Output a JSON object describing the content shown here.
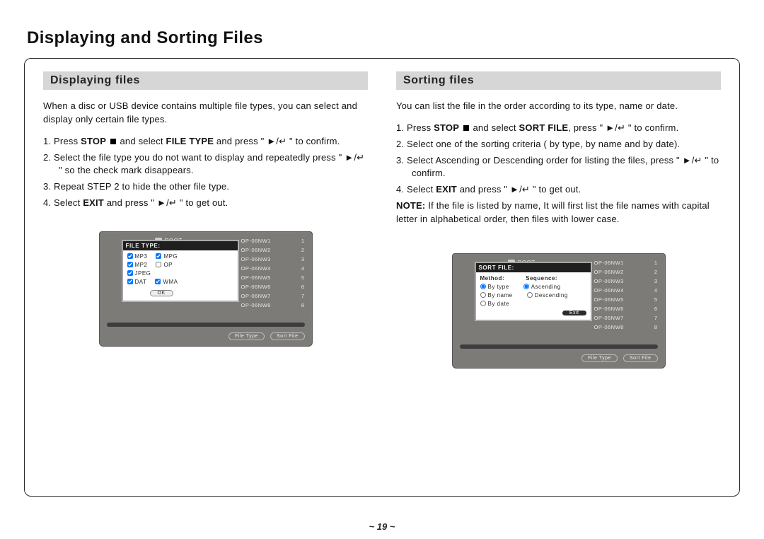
{
  "page_title": "Displaying and Sorting Files",
  "page_number": "~ 19 ~",
  "left": {
    "heading": "Displaying files",
    "intro": "When a disc or USB device contains multiple file types,    you can select and display only certain file types.",
    "steps": [
      {
        "prefix": "1. Press ",
        "b1": "STOP ",
        "mid": "",
        "b2": " and select ",
        "b3": "FILE TYPE",
        "tail": " and press \" ►/↵ \" to confirm."
      },
      {
        "text": "2. Select the file type you do not want to display and repeatedly press \" ►/↵ \" so the check mark disappears."
      },
      {
        "text": "3. Repeat STEP 2 to hide the other file type."
      },
      {
        "prefix": "4. Select ",
        "b1": "EXIT",
        "tail": " and press \" ►/↵ \" to get out."
      }
    ],
    "osd": {
      "root": "ROOT",
      "panel_title": "FILE TYPE:",
      "checks_left": [
        "MP3",
        "MP2",
        "JPEG",
        "DAT"
      ],
      "checks_right": [
        "MPG",
        "OP",
        "",
        "WMA"
      ],
      "ok": "OK",
      "files": [
        "OP-06NW1",
        "OP-06NW2",
        "OP-06NW3",
        "OP-06NW4",
        "OP-06NW5",
        "OP-06NW6",
        "OP-06NW7",
        "OP-06NW8"
      ],
      "foot1": "File Type",
      "foot2": "Sort File"
    }
  },
  "right": {
    "heading": "Sorting files",
    "intro": "You can list the file in the order according to its type, name or date.",
    "steps": [
      {
        "prefix": "1. Press ",
        "b1": "STOP ",
        "b2": " and select ",
        "b3": "SORT FILE",
        "tail": ", press \" ►/↵ \" to confirm."
      },
      {
        "text": "2. Select one of the sorting criteria ( by type, by name and by date)."
      },
      {
        "text": "3. Select Ascending or Descending order for listing the files, press \" ►/↵ \" to confirm."
      },
      {
        "prefix": "4. Select ",
        "b1": "EXIT",
        "tail": " and press \" ►/↵ \" to get out."
      }
    ],
    "note_label": "NOTE:",
    "note_body": " If the file is listed by name, It will first list the file names with capital letter in alphabetical order, then files with lower case.",
    "osd": {
      "root": "ROOT",
      "panel_title": "SORT FILE:",
      "method": "Method:",
      "seq": "Sequence:",
      "radios_left": [
        "By type",
        "By name",
        "By date"
      ],
      "radios_right": [
        "Ascending",
        "Descending",
        ""
      ],
      "exit": "Exit",
      "files": [
        "OP-06NW1",
        "OP-06NW2",
        "OP-06NW3",
        "OP-06NW4",
        "OP-06NW5",
        "OP-06NW6",
        "OP-06NW7",
        "OP-06NW8"
      ],
      "foot1": "File Type",
      "foot2": "Sort File"
    }
  }
}
